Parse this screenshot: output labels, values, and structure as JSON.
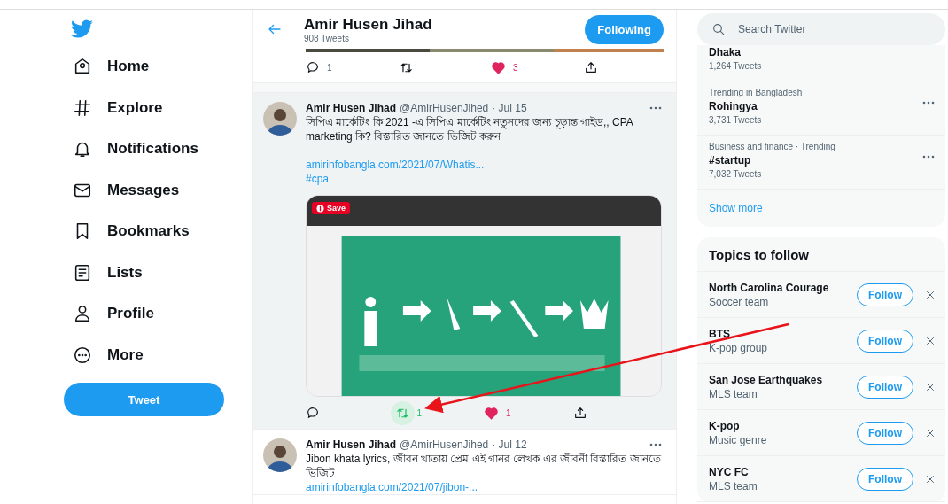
{
  "nav": {
    "items": [
      {
        "label": "Home",
        "kind": "home"
      },
      {
        "label": "Explore",
        "kind": "hash"
      },
      {
        "label": "Notifications",
        "kind": "bell"
      },
      {
        "label": "Messages",
        "kind": "mail"
      },
      {
        "label": "Bookmarks",
        "kind": "bookmark"
      },
      {
        "label": "Lists",
        "kind": "list"
      },
      {
        "label": "Profile",
        "kind": "person"
      },
      {
        "label": "More",
        "kind": "more"
      }
    ],
    "tweet_button": "Tweet"
  },
  "header": {
    "title": "Amir Husen Jihad",
    "subtitle": "908 Tweets",
    "follow_button": "Following"
  },
  "previous_tweet_actions": {
    "replies": "1",
    "likes": "3",
    "liked": true,
    "retweeted": false
  },
  "tweets": [
    {
      "name": "Amir Husen Jihad",
      "handle": "@AmirHusenJihed",
      "date": "· Jul 15",
      "highlighted": true,
      "text": "সিপিএ মার্কেটিং কি 2021 -এ সিপিএ মার্কেটিং নতুনদের জন্য চূড়ান্ত গাইড,,  CPA marketing কি?  বিস্তারিত জানতে ভিজিট করুন",
      "links": [
        "amirinfobangla.com/2021/07/Whatis...",
        "#cpa"
      ],
      "media": {
        "kind": "picture",
        "save_button": "Save"
      },
      "actions": {
        "retweets": "1",
        "likes": "1",
        "liked": true,
        "retweeted": true
      }
    },
    {
      "name": "Amir Husen Jihad",
      "handle": "@AmirHusenJihed",
      "date": "· Jul 12",
      "highlighted": false,
      "text": "Jibon khata lyrics,  জীবন খাতায় প্রেম এই গানর লেখক এর জীবনী বিস্তারিত জানতে ভিজিট",
      "links": [
        "amirinfobangla.com/2021/07/jibon-..."
      ]
    }
  ],
  "search": {
    "placeholder": "Search Twitter"
  },
  "trends": {
    "items": [
      {
        "name": "Dhaka",
        "count": "1,264 Tweets"
      },
      {
        "context": "Trending in Bangladesh",
        "name": "Rohingya",
        "count": "3,731 Tweets"
      },
      {
        "context": "Business and finance · Trending",
        "name": "#startup",
        "count": "7,032 Tweets"
      }
    ],
    "show_more": "Show more"
  },
  "topics": {
    "title": "Topics to follow",
    "items": [
      {
        "name": "North Carolina Courage",
        "category": "Soccer team",
        "button": "Follow"
      },
      {
        "name": "BTS",
        "category": "K-pop group",
        "button": "Follow"
      },
      {
        "name": "San Jose Earthquakes",
        "category": "MLS team",
        "button": "Follow"
      },
      {
        "name": "K-pop",
        "category": "Music genre",
        "button": "Follow"
      },
      {
        "name": "NYC FC",
        "category": "MLS team",
        "button": "Follow"
      }
    ]
  }
}
